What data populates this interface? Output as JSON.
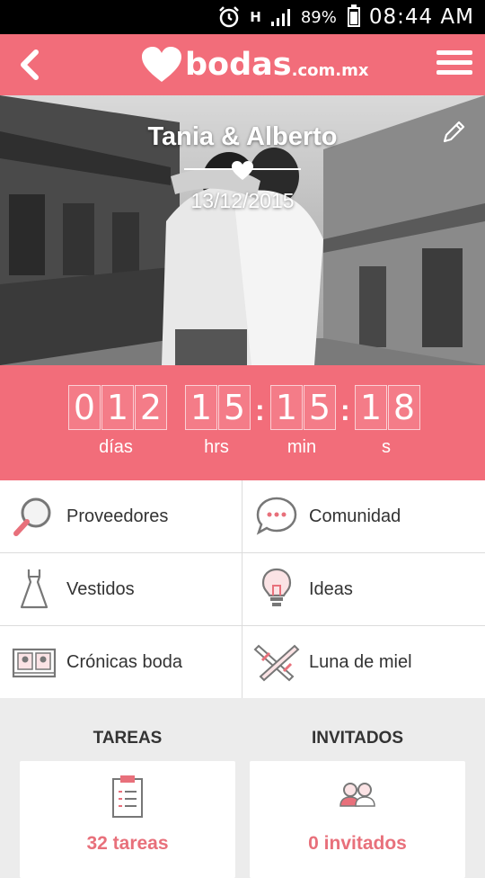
{
  "status_bar": {
    "battery_percent": "89%",
    "time": "08:44 AM",
    "network_label": "H",
    "icons": [
      "alarm-icon",
      "signal-icon",
      "battery-icon"
    ]
  },
  "app_bar": {
    "logo_word": "bodas",
    "logo_domain": ".com.mx",
    "icons": [
      "back-arrow-icon",
      "hamburger-menu-icon"
    ]
  },
  "hero": {
    "couple": "Tania & Alberto",
    "date": "13/12/2015",
    "edit_icon": "pencil-icon"
  },
  "countdown": {
    "days": [
      "0",
      "1",
      "2"
    ],
    "hours": [
      "1",
      "5"
    ],
    "minutes": [
      "1",
      "5"
    ],
    "seconds": [
      "1",
      "8"
    ],
    "labels": {
      "days": "días",
      "hours": "hrs",
      "minutes": "min",
      "seconds": "s"
    }
  },
  "menu": {
    "items": [
      {
        "label": "Proveedores",
        "icon": "magnifier-icon"
      },
      {
        "label": "Comunidad",
        "icon": "chat-bubble-icon"
      },
      {
        "label": "Vestidos",
        "icon": "dress-icon"
      },
      {
        "label": "Ideas",
        "icon": "lightbulb-icon"
      },
      {
        "label": "Crónicas boda",
        "icon": "photo-album-icon"
      },
      {
        "label": "Luna de miel",
        "icon": "airplanes-icon"
      }
    ]
  },
  "dashboard": {
    "tasks": {
      "title": "TAREAS",
      "count": "32 tareas",
      "icon": "clipboard-icon"
    },
    "guests": {
      "title": "INVITADOS",
      "count": "0 invitados",
      "icon": "guests-icon"
    }
  },
  "colors": {
    "brand": "#f26d7a",
    "accent_text": "#e8707b"
  }
}
